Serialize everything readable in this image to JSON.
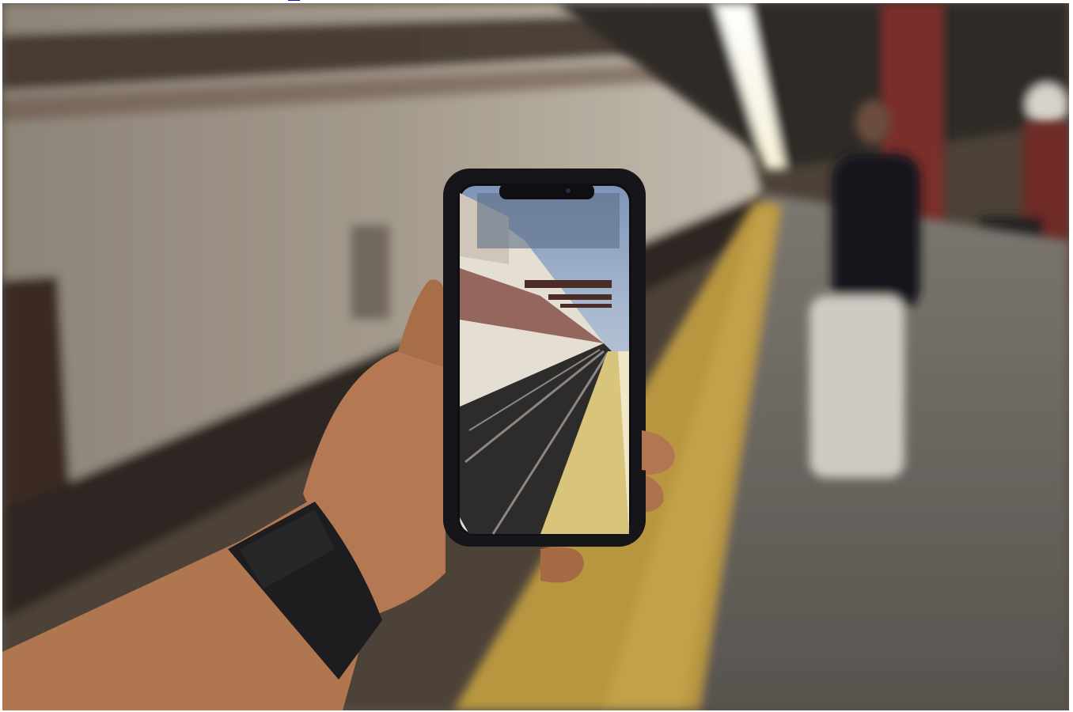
{
  "page": {
    "link_text": "link"
  },
  "photo": {
    "subject": "hand-holding-smartphone-on-subway-platform",
    "colors": {
      "wall": "#9d9488",
      "wall_dark": "#3b2c24",
      "platform": "#6d6a64",
      "yellow_strip": "#c6a24a",
      "pillar": "#7a2e2a",
      "skin": "#b57a52",
      "watch_band": "#1d1d1f",
      "phone_frame": "#15151a",
      "phone_screen_sky": "#8fa7c8",
      "rail": "#4a4a4e"
    }
  }
}
